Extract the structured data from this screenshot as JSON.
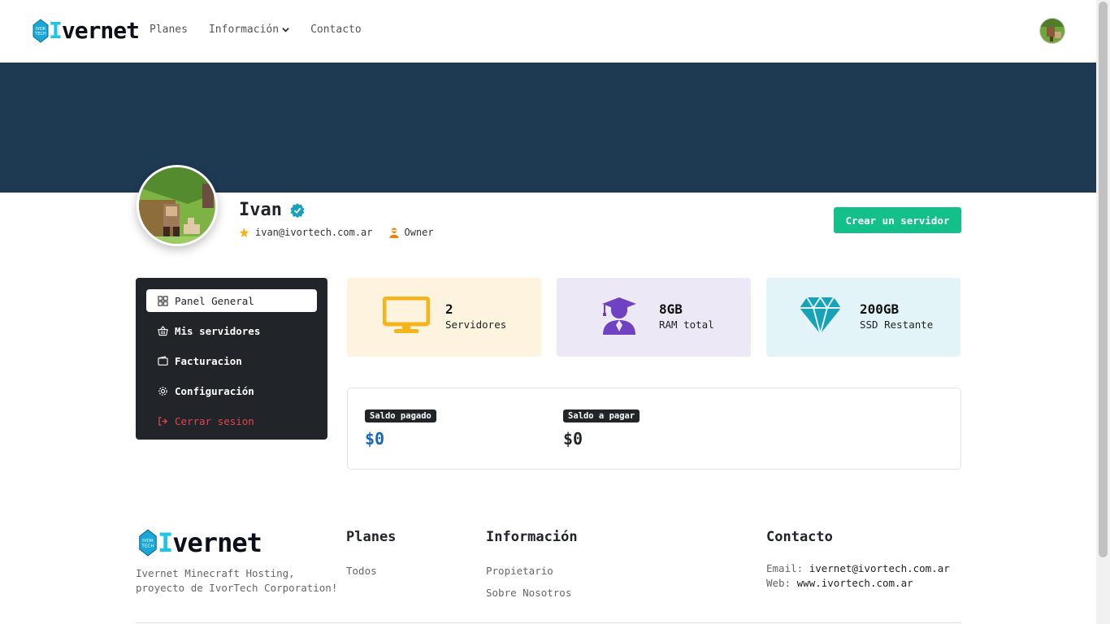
{
  "nav": {
    "brand": "Ivernet",
    "brand_badge": "IVOR TECH",
    "links": [
      {
        "label": "Planes"
      },
      {
        "label": "Información"
      },
      {
        "label": "Contacto"
      }
    ]
  },
  "profile": {
    "name": "Ivan",
    "email": "ivan@ivortech.com.ar",
    "role": "Owner",
    "create_button": "Crear un servidor"
  },
  "sidebar": {
    "items": [
      {
        "label": "Panel General",
        "icon": "grid-icon"
      },
      {
        "label": "Mis servidores",
        "icon": "basket-icon"
      },
      {
        "label": "Facturacion",
        "icon": "wallet-icon"
      },
      {
        "label": "Configuración",
        "icon": "gear-icon"
      },
      {
        "label": "Cerrar sesion",
        "icon": "logout-icon"
      }
    ]
  },
  "stats": [
    {
      "value": "2",
      "label": "Servidores",
      "icon": "monitor-icon",
      "bg": "#fdf3df",
      "color": "#f5b419"
    },
    {
      "value": "8GB",
      "label": "RAM total",
      "icon": "graduate-icon",
      "bg": "#ede8f6",
      "color": "#6f42c1"
    },
    {
      "value": "200GB",
      "label": "SSD Restante",
      "icon": "diamond-icon",
      "bg": "#e2f4f8",
      "color": "#17a2b8"
    }
  ],
  "balance": {
    "paid_label": "Saldo pagado",
    "paid_value": "$0",
    "due_label": "Saldo a pagar",
    "due_value": "$0"
  },
  "footer": {
    "brand": "Ivernet",
    "desc_line1": "Ivernet Minecraft Hosting,",
    "desc_line2": "proyecto de IvorTech Corporation!",
    "planes_title": "Planes",
    "planes_links": [
      "Todos"
    ],
    "info_title": "Información",
    "info_links": [
      "Propietario",
      "Sobre Nosotros"
    ],
    "contact_title": "Contacto",
    "email_label": "Email:",
    "email_value": "ivernet@ivortech.com.ar",
    "web_label": "Web:",
    "web_value": "www.ivortech.com.ar"
  },
  "colors": {
    "banner": "#1e3a52",
    "accent": "#13c08a",
    "paid_amount": "#1565c0",
    "logout": "#e0444f"
  }
}
